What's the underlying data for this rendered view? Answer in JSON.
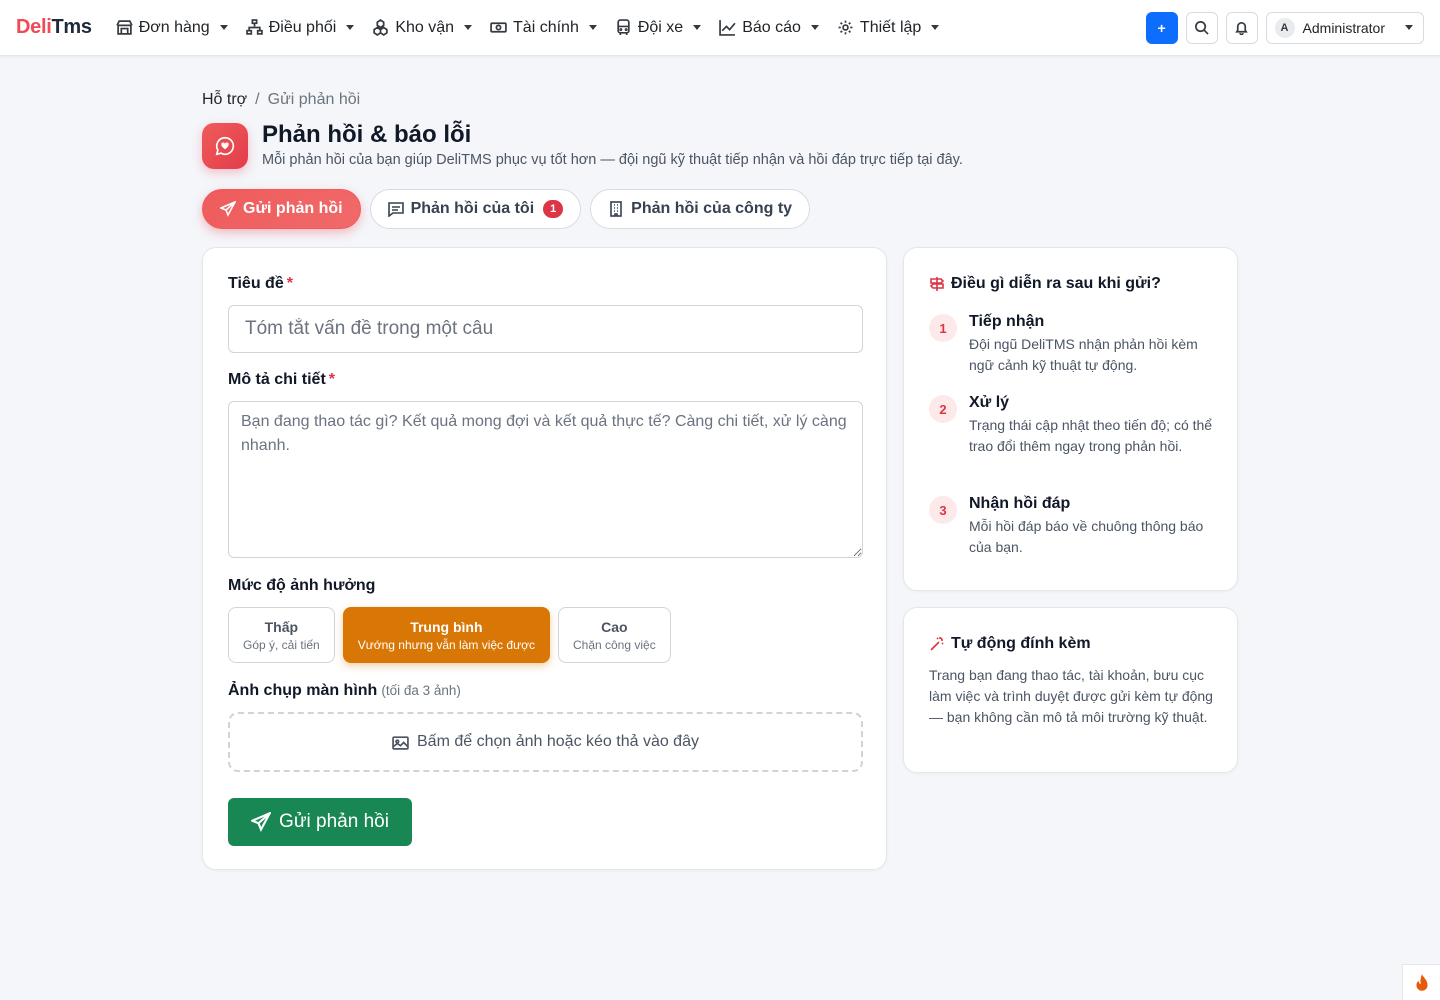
{
  "brand": {
    "part1": "Deli",
    "part2": "Tms"
  },
  "nav": [
    {
      "label": "Đơn hàng",
      "icon": "store-icon"
    },
    {
      "label": "Điều phối",
      "icon": "network-icon"
    },
    {
      "label": "Kho vận",
      "icon": "boxes-icon"
    },
    {
      "label": "Tài chính",
      "icon": "cash-icon"
    },
    {
      "label": "Đội xe",
      "icon": "bus-icon"
    },
    {
      "label": "Báo cáo",
      "icon": "chart-icon"
    },
    {
      "label": "Thiết lập",
      "icon": "gear-icon"
    }
  ],
  "header_actions": {
    "add": "+",
    "user_initial": "A",
    "user_name": "Administrator"
  },
  "breadcrumb": {
    "parent": "Hỗ trợ",
    "separator": "/",
    "current": "Gửi phản hồi"
  },
  "page": {
    "title": "Phản hồi & báo lỗi",
    "subtitle": "Mỗi phản hồi của bạn giúp DeliTMS phục vụ tốt hơn — đội ngũ kỹ thuật tiếp nhận và hồi đáp trực tiếp tại đây."
  },
  "tabs": [
    {
      "label": "Gửi phản hồi",
      "active": true
    },
    {
      "label": "Phản hồi của tôi",
      "badge": "1"
    },
    {
      "label": "Phản hồi của công ty"
    }
  ],
  "form": {
    "title_label": "Tiêu đề",
    "required_mark": "*",
    "title_placeholder": "Tóm tắt vấn đề trong một câu",
    "desc_label": "Mô tả chi tiết",
    "desc_placeholder": "Bạn đang thao tác gì? Kết quả mong đợi và kết quả thực tế? Càng chi tiết, xử lý càng nhanh.",
    "severity_label": "Mức độ ảnh hưởng",
    "severity": [
      {
        "title": "Thấp",
        "desc": "Góp ý, cải tiến"
      },
      {
        "title": "Trung bình",
        "desc": "Vướng nhưng vẫn làm việc được",
        "selected": true
      },
      {
        "title": "Cao",
        "desc": "Chặn công việc"
      }
    ],
    "screenshot_label": "Ảnh chụp màn hình",
    "screenshot_hint": "(tối đa 3 ảnh)",
    "dropzone_text": "Bấm để chọn ảnh hoặc kéo thả vào đây",
    "submit_label": "Gửi phản hồi"
  },
  "process": {
    "title": "Điều gì diễn ra sau khi gửi?",
    "steps": [
      {
        "num": "1",
        "title": "Tiếp nhận",
        "desc": "Đội ngũ DeliTMS nhận phản hồi kèm ngữ cảnh kỹ thuật tự động."
      },
      {
        "num": "2",
        "title": "Xử lý",
        "desc": "Trạng thái cập nhật theo tiến độ; có thể trao đổi thêm ngay trong phản hồi."
      },
      {
        "num": "3",
        "title": "Nhận hồi đáp",
        "desc": "Mỗi hồi đáp báo về chuông thông báo của bạn."
      }
    ]
  },
  "auto_attach": {
    "title": "Tự động đính kèm",
    "text": "Trang bạn đang thao tác, tài khoản, bưu cục làm việc và trình duyệt được gửi kèm tự động — bạn không cần mô tả môi trường kỹ thuật."
  },
  "colors": {
    "brand_red": "#ef4a55",
    "primary": "#0d6efd",
    "success": "#198754",
    "warning": "#d97706",
    "danger": "#dc3545"
  }
}
